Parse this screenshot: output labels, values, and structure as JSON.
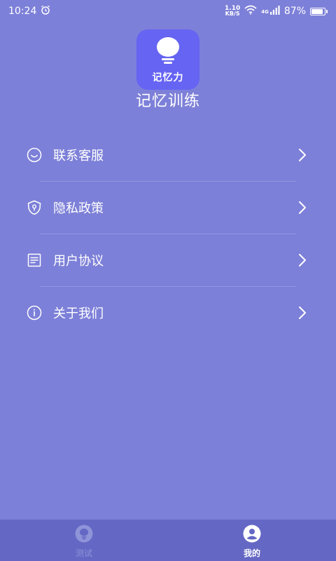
{
  "status_bar": {
    "time": "10:24",
    "net_speed_value": "1.10",
    "net_speed_unit": "KB/S",
    "network_type": "4G",
    "battery_percent": "87%",
    "battery_level": 0.87
  },
  "app": {
    "logo_text": "记忆力",
    "name": "记忆训练",
    "logo_color": "#6664f3"
  },
  "menu": {
    "items": [
      {
        "label": "联系客服",
        "icon": "smile-icon"
      },
      {
        "label": "隐私政策",
        "icon": "shield-icon"
      },
      {
        "label": "用户协议",
        "icon": "document-icon"
      },
      {
        "label": "关于我们",
        "icon": "info-icon"
      }
    ]
  },
  "tab_bar": {
    "tabs": [
      {
        "label": "测试",
        "icon": "bulb-icon",
        "active": false
      },
      {
        "label": "我的",
        "icon": "user-icon",
        "active": true
      }
    ]
  },
  "colors": {
    "background": "#7d80d8",
    "tab_bar": "#6467c4",
    "inactive_tab": "#8f93d8"
  }
}
